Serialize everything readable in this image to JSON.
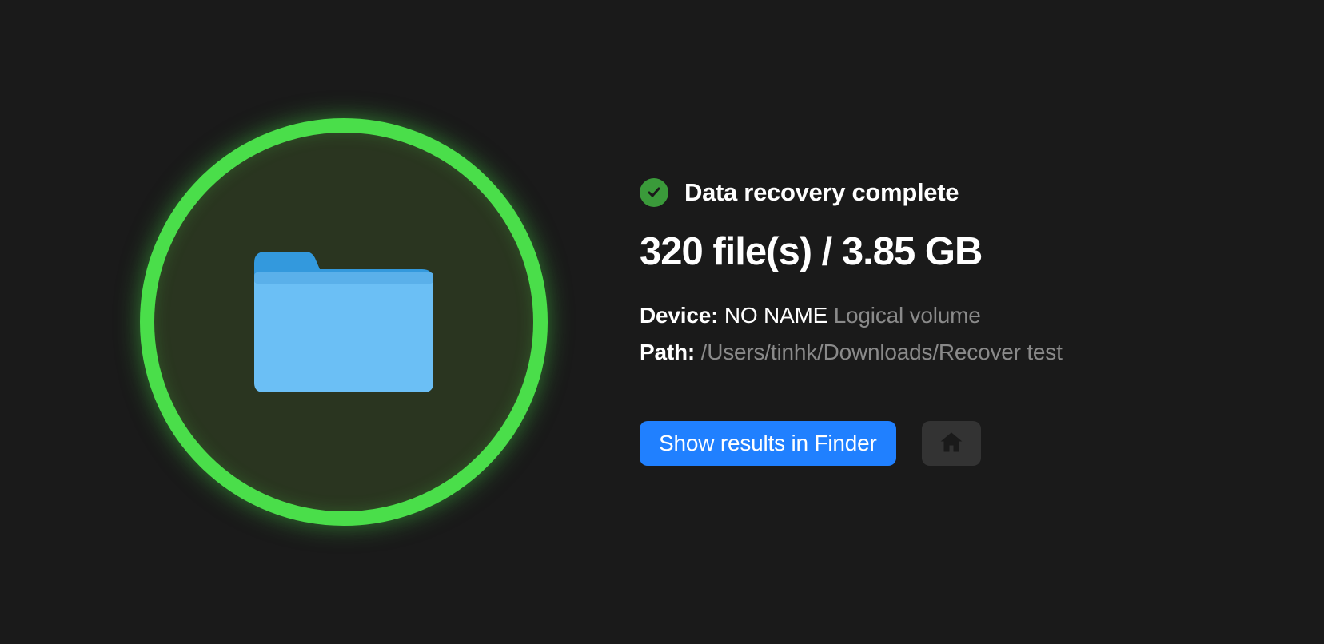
{
  "status": {
    "title": "Data recovery complete"
  },
  "summary": {
    "file_count": 320,
    "file_size": "3.85 GB",
    "combined": "320 file(s) / 3.85 GB"
  },
  "device": {
    "label": "Device:",
    "name": "NO NAME",
    "type": "Logical volume"
  },
  "path": {
    "label": "Path:",
    "value": "/Users/tinhk/Downloads/Recover test"
  },
  "actions": {
    "show_results_label": "Show results in Finder"
  },
  "colors": {
    "accent_green": "#4ade4a",
    "accent_blue": "#2080ff",
    "check_green": "#3a9a3a"
  }
}
